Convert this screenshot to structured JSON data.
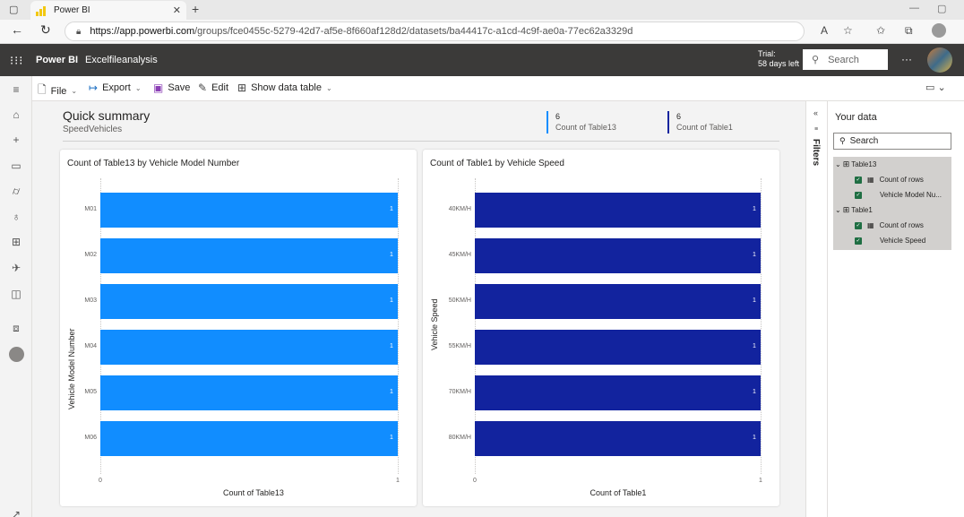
{
  "browser": {
    "tab_title": "Power BI",
    "tab_close": "✕",
    "new_tab": "+",
    "url_host": "https://app.powerbi.com",
    "url_path": "/groups/fce0455c-5279-42d7-af5e-8f660af128d2/datasets/ba44417c-a1cd-4c9f-ae0a-77ec62a3329d"
  },
  "header": {
    "brand": "Power BI",
    "workspace": "Excelfileanalysis",
    "trial_line1": "Trial:",
    "trial_line2": "58 days left",
    "search_placeholder": "Search",
    "more": "···"
  },
  "toolbar": {
    "file": "File",
    "export": "Export",
    "save": "Save",
    "edit": "Edit",
    "show_data_table": "Show data table"
  },
  "summary": {
    "title": "Quick summary",
    "subtitle": "SpeedVehicles",
    "cards": [
      {
        "value": "6",
        "label": "Count of Table13",
        "color": "#118dff"
      },
      {
        "value": "6",
        "label": "Count of Table1",
        "color": "#12239e"
      }
    ]
  },
  "charts": {
    "left": {
      "title": "Count of Table13 by Vehicle Model Number",
      "ylabel": "Vehicle Model Number",
      "xlabel": "Count of Table13",
      "color": "#118dff"
    },
    "right": {
      "title": "Count of Table1 by Vehicle Speed",
      "ylabel": "Vehicle Speed",
      "xlabel": "Count of Table1",
      "color": "#12239e"
    }
  },
  "chart_data": [
    {
      "type": "bar",
      "orientation": "horizontal",
      "title": "Count of Table13 by Vehicle Model Number",
      "xlabel": "Count of Table13",
      "ylabel": "Vehicle Model Number",
      "categories": [
        "M01",
        "M02",
        "M03",
        "M04",
        "M05",
        "M06"
      ],
      "values": [
        1,
        1,
        1,
        1,
        1,
        1
      ],
      "xlim": [
        0,
        1
      ],
      "xticks": [
        "0",
        "1"
      ],
      "data_labels": true
    },
    {
      "type": "bar",
      "orientation": "horizontal",
      "title": "Count of Table1 by Vehicle Speed",
      "xlabel": "Count of Table1",
      "ylabel": "Vehicle Speed",
      "categories": [
        "40KM/H",
        "45KM/H",
        "50KM/H",
        "55KM/H",
        "70KM/H",
        "80KM/H"
      ],
      "values": [
        1,
        1,
        1,
        1,
        1,
        1
      ],
      "xlim": [
        0,
        1
      ],
      "xticks": [
        "0",
        "1"
      ],
      "data_labels": true
    }
  ],
  "filters": {
    "label": "Filters",
    "collapse": "«"
  },
  "data_pane": {
    "title": "Your data",
    "search_placeholder": "Search",
    "tables": [
      {
        "name": "Table13",
        "fields": [
          "Count of rows",
          "Vehicle Model Nu..."
        ]
      },
      {
        "name": "Table1",
        "fields": [
          "Count of rows",
          "Vehicle Speed"
        ]
      }
    ]
  }
}
